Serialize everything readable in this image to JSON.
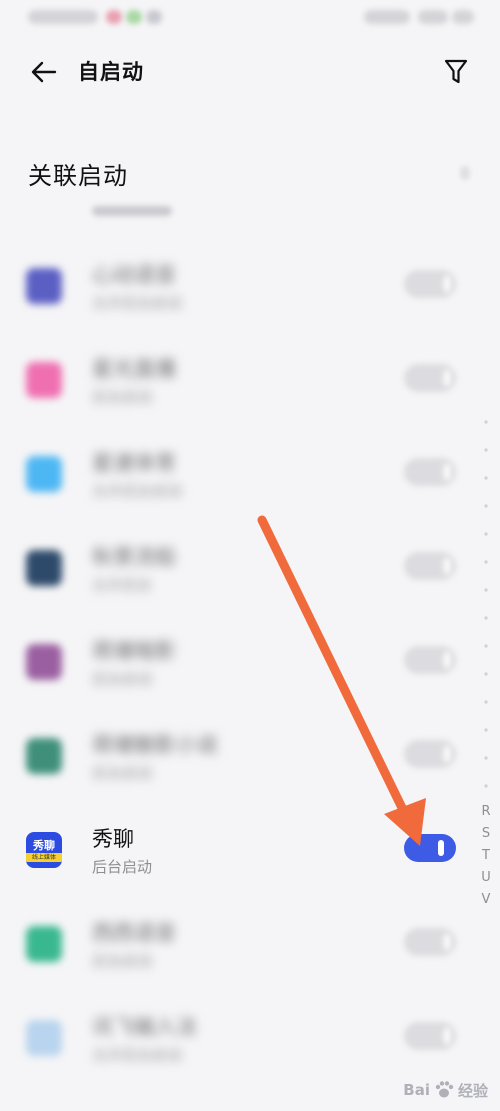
{
  "header": {
    "title": "自启动"
  },
  "section": {
    "title": "关联启动"
  },
  "apps": [
    {
      "name": "心动语音",
      "subtitle": "允许后台启动",
      "icon_color": "#5b5fc4",
      "enabled": false,
      "blurred": true
    },
    {
      "name": "星光直播",
      "subtitle": "后台启动",
      "icon_color": "#ef6fb0",
      "enabled": false,
      "blurred": true
    },
    {
      "name": "星速体育",
      "subtitle": "允许后台启动",
      "icon_color": "#4db7f3",
      "enabled": false,
      "blurred": true
    },
    {
      "name": "秋景流船",
      "subtitle": "允许后台",
      "icon_color": "#2d4a6a",
      "enabled": false,
      "blurred": true
    },
    {
      "name": "荷塘暗影",
      "subtitle": "后台启动",
      "icon_color": "#9a5fa0",
      "enabled": false,
      "blurred": true
    },
    {
      "name": "荷塘魅影小说",
      "subtitle": "后台启动",
      "icon_color": "#3f8f7a",
      "enabled": false,
      "blurred": true
    },
    {
      "name": "秀聊",
      "subtitle": "后台启动",
      "icon_color": "#2c4be0",
      "icon_text": "秀聊",
      "icon_subtext": "线上媒体",
      "enabled": true,
      "blurred": false
    },
    {
      "name": "西西语音",
      "subtitle": "后台启动",
      "icon_color": "#39b88f",
      "enabled": false,
      "blurred": true
    },
    {
      "name": "讯飞输入法",
      "subtitle": "允许后台启动",
      "icon_color": "#b8d4ee",
      "enabled": false,
      "blurred": true
    }
  ],
  "index_bar": {
    "letters": [
      "R",
      "S",
      "T",
      "U",
      "V"
    ]
  },
  "annotation": {
    "arrow_color": "#f06a3c"
  },
  "watermark": {
    "brand": "Bai",
    "suffix": "经验"
  }
}
